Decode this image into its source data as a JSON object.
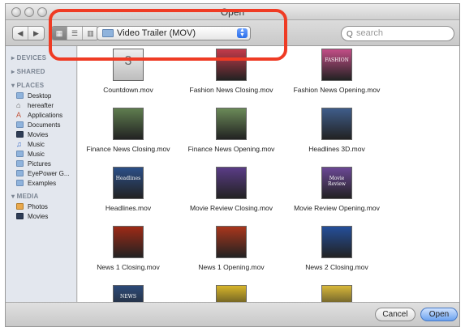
{
  "window": {
    "title": "Open"
  },
  "toolbar": {
    "back_label": "◀",
    "forward_label": "▶",
    "view_icon": "▦",
    "view_list": "☰",
    "view_columns": "▥",
    "location": "Video Trailer (MOV)",
    "search_placeholder": "search"
  },
  "sidebar": {
    "sections": {
      "devices": "▸ DEVICES",
      "shared": "▸ SHARED",
      "places": "▾ PLACES",
      "media": "▾ MEDIA"
    },
    "places": [
      {
        "label": "Desktop",
        "icon": "folder-icon"
      },
      {
        "label": "hereafter",
        "icon": "home-icon"
      },
      {
        "label": "Applications",
        "icon": "applications-icon"
      },
      {
        "label": "Documents",
        "icon": "documents-icon"
      },
      {
        "label": "Movies",
        "icon": "movies-icon"
      },
      {
        "label": "Music",
        "icon": "music-icon"
      },
      {
        "label": "Music",
        "icon": "folder-icon"
      },
      {
        "label": "Pictures",
        "icon": "pictures-icon"
      },
      {
        "label": "EyePower G...",
        "icon": "folder-icon"
      },
      {
        "label": "Examples",
        "icon": "folder-icon"
      }
    ],
    "media": [
      {
        "label": "Photos",
        "icon": "photos-icon"
      },
      {
        "label": "Movies",
        "icon": "movies-icon"
      }
    ]
  },
  "files": [
    {
      "name": "Countdown.mov",
      "thumb": "3",
      "color": "#d8d8d8"
    },
    {
      "name": "Fashion News Closing.mov",
      "thumb": "",
      "color": "#c43a4a"
    },
    {
      "name": "Fashion News Opening.mov",
      "thumb": "FASHION",
      "color": "#c24d86"
    },
    {
      "name": "Finance News Closing.mov",
      "thumb": "",
      "color": "#5f7d4f"
    },
    {
      "name": "Finance News Opening.mov",
      "thumb": "",
      "color": "#6b8a58"
    },
    {
      "name": "Headlines 3D.mov",
      "thumb": "",
      "color": "#3f5d8a"
    },
    {
      "name": "Headlines.mov",
      "thumb": "Headlines",
      "color": "#2b4f87"
    },
    {
      "name": "Movie Review Closing.mov",
      "thumb": "",
      "color": "#5a3c86"
    },
    {
      "name": "Movie Review Opening.mov",
      "thumb": "Movie Review",
      "color": "#6b4894"
    },
    {
      "name": "News 1 Closing.mov",
      "thumb": "",
      "color": "#9e2a16"
    },
    {
      "name": "News 1 Opening.mov",
      "thumb": "",
      "color": "#a9361c"
    },
    {
      "name": "News 2 Closing.mov",
      "thumb": "",
      "color": "#244f9a"
    },
    {
      "name": "",
      "thumb": "NEWS",
      "color": "#2c4a78"
    },
    {
      "name": "",
      "thumb": "",
      "color": "#d8b62a"
    },
    {
      "name": "",
      "thumb": "",
      "color": "#d9b93a"
    }
  ],
  "buttons": {
    "cancel": "Cancel",
    "open": "Open"
  }
}
